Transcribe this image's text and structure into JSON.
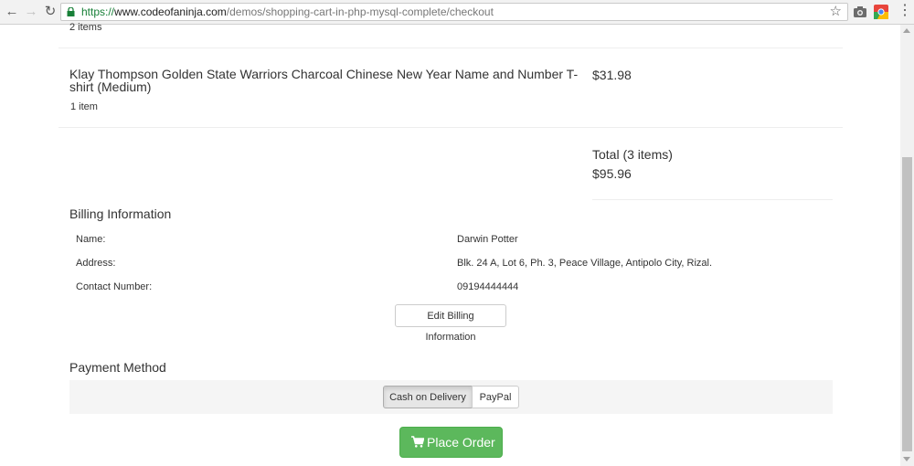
{
  "browser": {
    "url_scheme": "https://",
    "url_host": "www.codeofaninja.com",
    "url_path": "/demos/shopping-cart-in-php-mysql-complete/checkout"
  },
  "cart": {
    "previous_item_qty": "2 items",
    "item": {
      "name": "Klay Thompson Golden State Warriors Charcoal Chinese New Year Name and Number T-shirt (Medium)",
      "price": "$31.98",
      "qty": "1 item"
    },
    "total_label": "Total (3 items)",
    "total_amount": "$95.96"
  },
  "billing": {
    "title": "Billing Information",
    "name_label": "Name:",
    "name_value": "Darwin Potter",
    "address_label": "Address:",
    "address_value": "Blk. 24 A, Lot 6, Ph. 3, Peace Village, Antipolo City, Rizal.",
    "contact_label": "Contact Number:",
    "contact_value": "09194444444",
    "edit_button": "Edit Billing Information"
  },
  "payment": {
    "title": "Payment Method",
    "options": [
      "Cash on Delivery",
      "PayPal"
    ],
    "selected": "Cash on Delivery"
  },
  "place_order": "Place Order",
  "colors": {
    "success": "#5cb85c",
    "url_secure": "#188038"
  }
}
